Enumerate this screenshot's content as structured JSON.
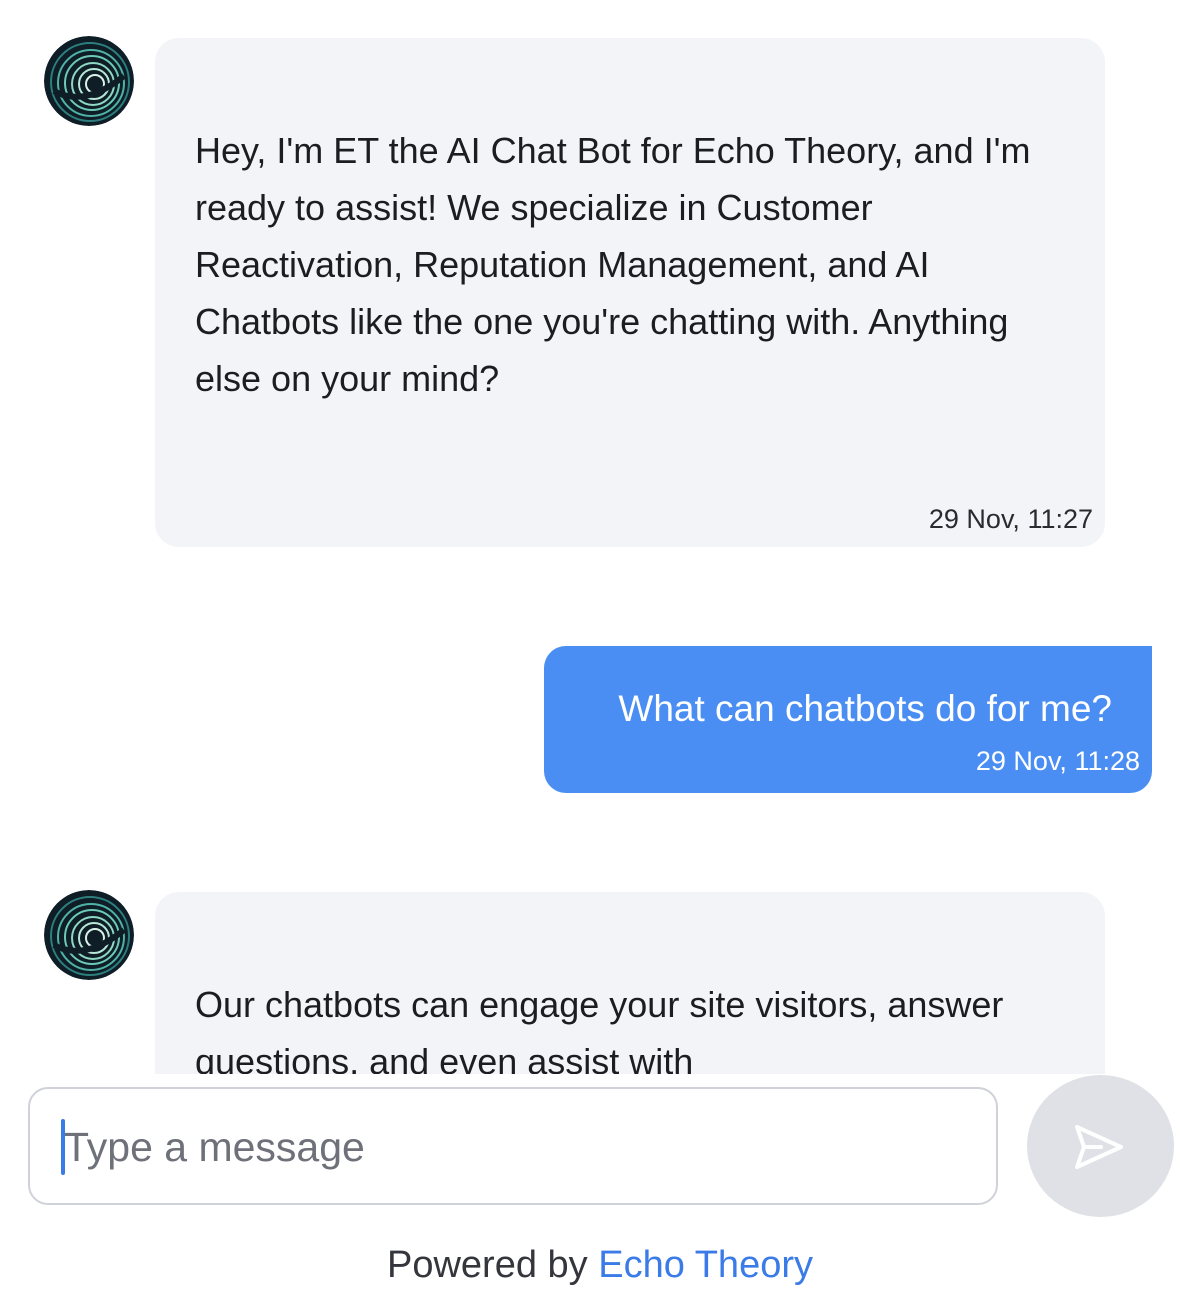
{
  "messages": [
    {
      "sender": "bot",
      "text": "Hey, I'm ET the AI Chat Bot for Echo Theory, and I'm ready to assist! We specialize in Customer Reactivation, Reputation Management, and AI Chatbots like the one you're chatting with. Anything else on your mind?",
      "time": "29 Nov, 11:27"
    },
    {
      "sender": "user",
      "text": "What can chatbots do for me?",
      "time": "29 Nov, 11:28"
    },
    {
      "sender": "bot",
      "text": "Our chatbots can engage your site visitors, answer questions, and even assist with"
    }
  ],
  "composer": {
    "placeholder": "Type a message",
    "value": "",
    "send_icon": "send-arrow-icon"
  },
  "footer": {
    "powered_by": "Powered by",
    "brand": "Echo Theory"
  },
  "avatar_icon": "echo-theory-logo-icon",
  "colors": {
    "user_bubble": "#4a8ef3",
    "bot_bubble": "#f3f4f8",
    "brand_link": "#3b7be8",
    "send_button": "#dfe1e6"
  }
}
